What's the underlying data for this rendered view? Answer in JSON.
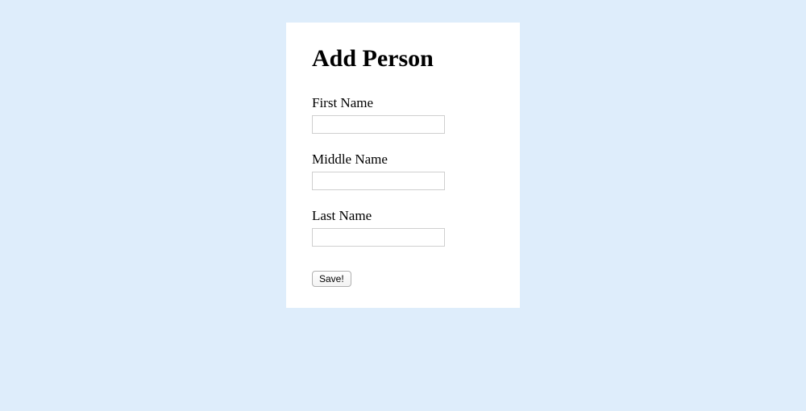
{
  "form": {
    "title": "Add Person",
    "fields": {
      "first_name": {
        "label": "First Name",
        "value": ""
      },
      "middle_name": {
        "label": "Middle Name",
        "value": ""
      },
      "last_name": {
        "label": "Last Name",
        "value": ""
      }
    },
    "save_label": "Save!"
  }
}
